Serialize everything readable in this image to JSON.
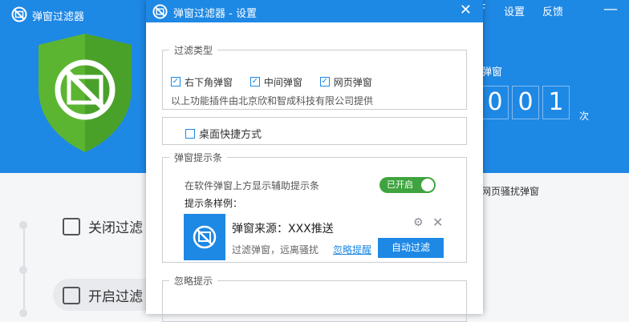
{
  "app": {
    "title": "弹窗过滤器",
    "top_links": {
      "settings": "设置",
      "feedback": "反馈",
      "menu": "F"
    },
    "counter": {
      "label": "弹窗",
      "digits": [
        "0",
        "0",
        "1"
      ],
      "unit": "次"
    },
    "sub_text": "网页骚扰弹窗",
    "items": [
      "关闭过滤",
      "开启过滤"
    ]
  },
  "modal": {
    "title": "弹窗过滤器 - 设置",
    "filter_type": {
      "legend": "过滤类型",
      "options": [
        {
          "label": "右下角弹窗",
          "checked": true
        },
        {
          "label": "中间弹窗",
          "checked": true
        },
        {
          "label": "网页弹窗",
          "checked": true
        }
      ],
      "note": "以上功能插件由北京欣和智成科技有限公司提供"
    },
    "shortcut": {
      "label": "桌面快捷方式",
      "checked": false
    },
    "tip_bar": {
      "legend": "弹窗提示条",
      "description": "在软件弹窗上方显示辅助提示条",
      "toggle_label": "已开启",
      "sample_label": "提示条样例：",
      "sample": {
        "title": "弹窗来源：XXX推送",
        "subtitle": "过滤弹窗，远离骚扰",
        "ignore_link": "忽略提醒",
        "button": "自动过滤"
      }
    },
    "ignore_tip": {
      "legend": "忽略提示"
    }
  },
  "colors": {
    "primary": "#1e88e5",
    "toggle_on": "#3fa43f",
    "shield_green": "#5cb531"
  }
}
